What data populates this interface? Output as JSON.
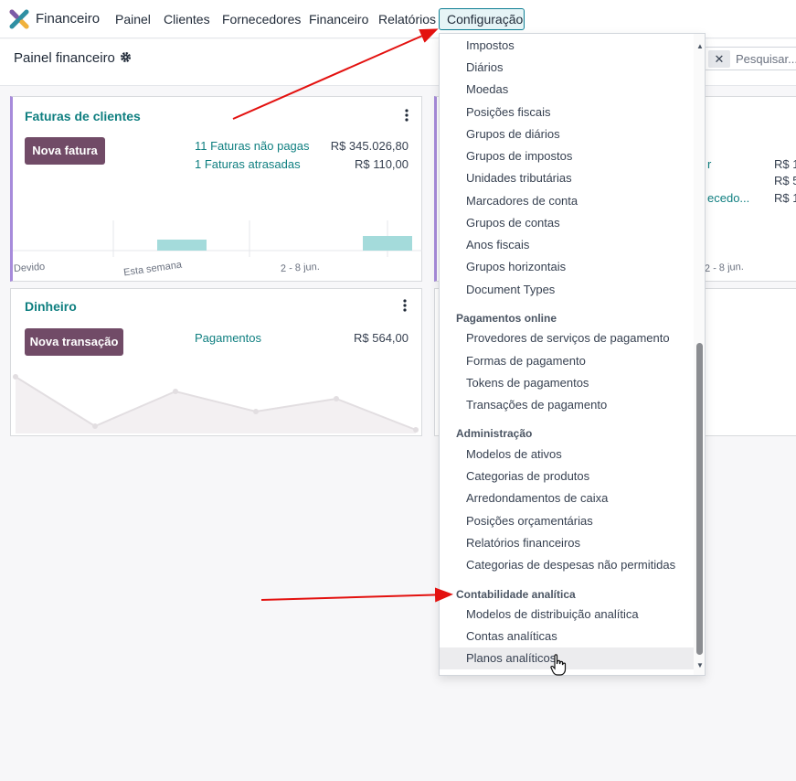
{
  "navbar": {
    "app_name": "Financeiro",
    "menu": [
      "Painel",
      "Clientes",
      "Fornecedores",
      "Financeiro",
      "Relatórios"
    ],
    "active_menu": "Configuração"
  },
  "control_panel": {
    "title": "Painel financeiro",
    "search_placeholder": "Pesquisar..."
  },
  "cards": {
    "invoices": {
      "title": "Faturas de clientes",
      "button": "Nova fatura",
      "lines": [
        {
          "label": "11 Faturas não pagas",
          "amount": "R$ 345.026,80"
        },
        {
          "label": "1 Faturas atrasadas",
          "amount": "R$ 110,00"
        }
      ],
      "chart_labels": [
        "Devido",
        "Esta semana",
        "2 - 8 jun."
      ]
    },
    "cash": {
      "title": "Dinheiro",
      "button": "Nova transação",
      "lines": [
        {
          "label": "Pagamentos",
          "amount": "R$ 564,00"
        }
      ]
    },
    "vendor_partial": {
      "lines": [
        "r",
        "ecedo..."
      ],
      "amounts": [
        "R$ 1",
        "R$ 5",
        "R$ 1"
      ],
      "chart_label": "2 - 8 jun."
    }
  },
  "dropdown": {
    "group_config": [
      "Impostos",
      "Diários",
      "Moedas",
      "Posições fiscais",
      "Grupos de diários",
      "Grupos de impostos",
      "Unidades tributárias",
      "Marcadores de conta",
      "Grupos de contas",
      "Anos fiscais",
      "Grupos horizontais",
      "Document Types"
    ],
    "header_payments": "Pagamentos online",
    "group_payments": [
      "Provedores de serviços de pagamento",
      "Formas de pagamento",
      "Tokens de pagamentos",
      "Transações de pagamento"
    ],
    "header_admin": "Administração",
    "group_admin": [
      "Modelos de ativos",
      "Categorias de produtos",
      "Arredondamentos de caixa",
      "Posições orçamentárias",
      "Relatórios financeiros",
      "Categorias de despesas não permitidas"
    ],
    "header_analytic": "Contabilidade analítica",
    "group_analytic": [
      "Modelos de distribuição analítica",
      "Contas analíticas",
      "Planos analíticos"
    ],
    "hovered_item": "Planos analíticos"
  },
  "colors": {
    "brand": "#714b67",
    "link": "#0f7f80",
    "active_border": "#0f7f94",
    "annotation_arrow": "#e3110f"
  }
}
